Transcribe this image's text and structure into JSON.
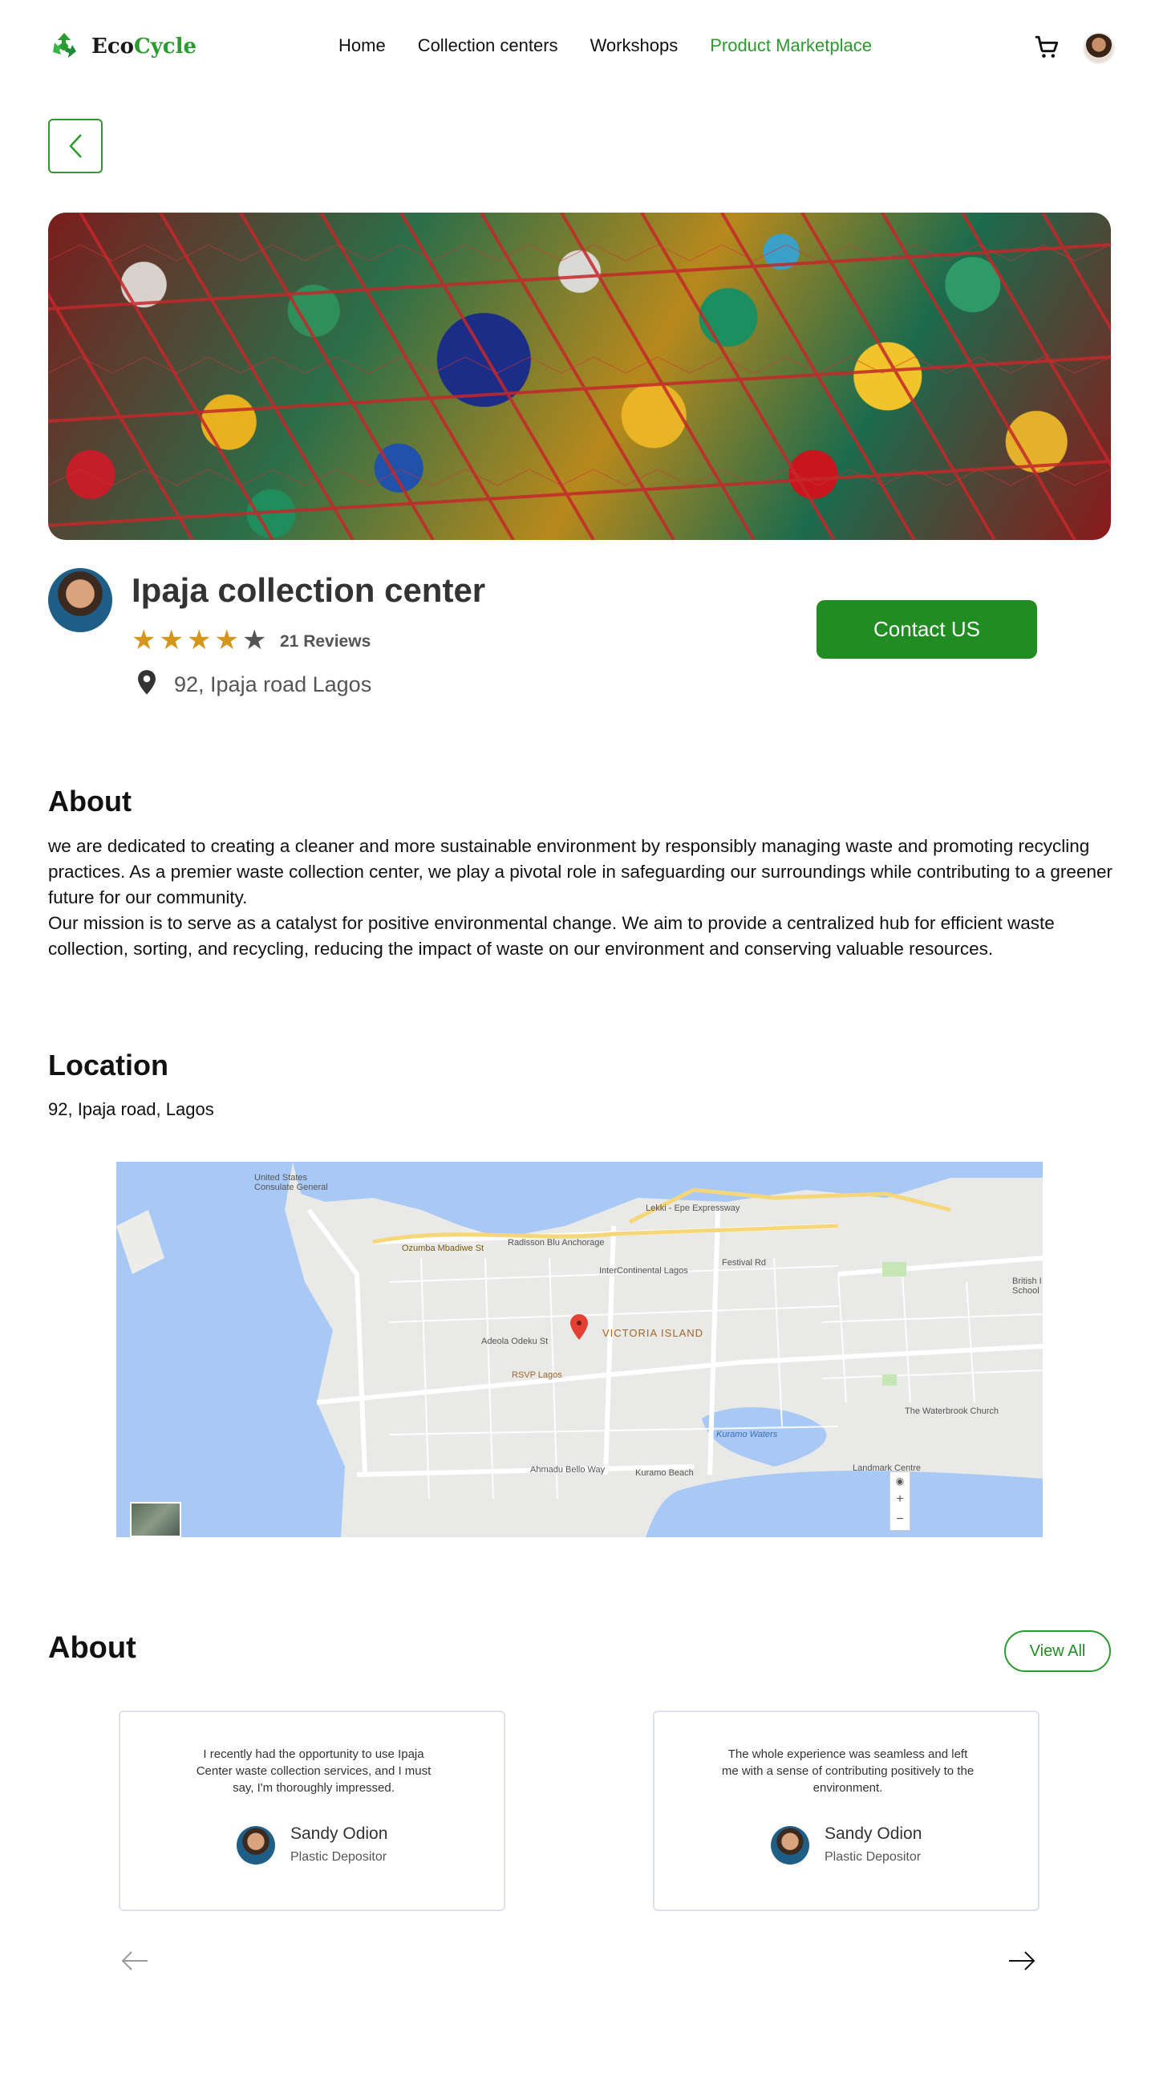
{
  "nav": {
    "logo_text_a": "Eco",
    "logo_text_b": "Cycle",
    "links": [
      "Home",
      "Collection centers",
      "Workshops",
      "Product Marketplace"
    ],
    "active_link": "Product Marketplace",
    "accent_color": "#2b9a2f"
  },
  "center": {
    "name": "Ipaja collection center",
    "rating": 4,
    "rating_max": 5,
    "reviews_label": "21 Reviews",
    "address": "92, Ipaja road Lagos",
    "contact_label": "Contact US"
  },
  "about": {
    "heading": "About",
    "text_1": "we are dedicated to creating a cleaner and more sustainable environment by responsibly managing waste and promoting recycling practices. As a premier waste collection center, we play a pivotal role in safeguarding our surroundings while contributing to a greener future for our community.",
    "text_2": "Our mission is to serve as a catalyst for positive environmental change. We aim to provide a centralized hub for efficient waste collection, sorting, and recycling, reducing the impact of waste on our environment and conserving valuable resources."
  },
  "location": {
    "heading": "Location",
    "address": "92, Ipaja road, Lagos",
    "map_labels": {
      "victoria_island": "VICTORIA ISLAND",
      "intercontinental": "InterContinental Lagos",
      "radisson": "Radisson Blu Anchorage",
      "ozumba": "Ozumba Mbadiwe St",
      "consulate": "United States Consulate General",
      "rsvp": "RSVP Lagos",
      "kuramo_waters": "Kuramo Waters",
      "kuramo_beach": "Kuramo Beach",
      "waterbrook": "The Waterbrook Church",
      "landmark": "Landmark Centre",
      "british": "British I School",
      "lekki_express": "Lekki - Epe Expressway",
      "festival": "Festival Rd",
      "adeola": "Adeola Odeku St",
      "ahmadu": "Ahmadu Bello Way"
    },
    "map_controls": [
      "+",
      "−"
    ]
  },
  "reviews": {
    "heading": "About",
    "view_all": "View All",
    "items": [
      {
        "quote": "I recently had the opportunity to use Ipaja Center waste collection services, and I must say, I'm thoroughly impressed.",
        "name": "Sandy Odion",
        "role": "Plastic Depositor"
      },
      {
        "quote": "The whole experience was seamless and left me with a sense of contributing positively to the environment.",
        "name": "Sandy Odion",
        "role": "Plastic Depositor"
      }
    ]
  },
  "icons": {
    "cart": "cart-icon",
    "back": "chevron-left-icon",
    "pin": "location-pin-icon",
    "prev": "arrow-left-icon",
    "next": "arrow-right-icon"
  }
}
